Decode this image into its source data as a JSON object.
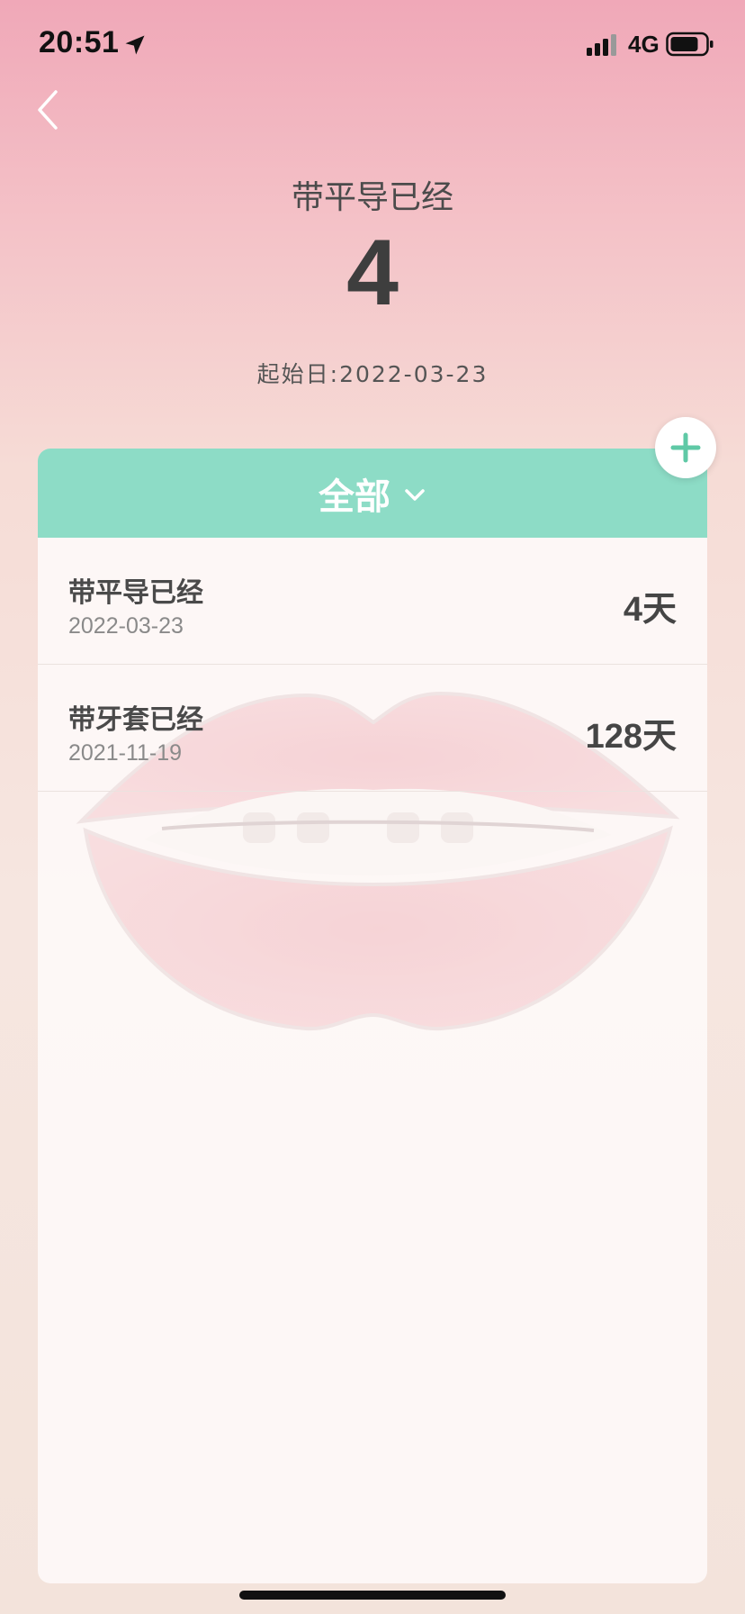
{
  "status_bar": {
    "time": "20:51",
    "network": "4G"
  },
  "header": {
    "title": "带平导已经",
    "count": "4",
    "start_date": "起始日:2022-03-23"
  },
  "filter": {
    "label": "全部"
  },
  "items": [
    {
      "title": "带平导已经",
      "date": "2022-03-23",
      "days": "4天"
    },
    {
      "title": "带牙套已经",
      "date": "2021-11-19",
      "days": "128天"
    }
  ],
  "colors": {
    "accent": "#8ddcc6",
    "add_icon": "#5fc9a6"
  },
  "icons": {
    "back": "chevron-left-icon",
    "add": "plus-icon",
    "filter_dropdown": "chevron-down-icon",
    "location": "location-arrow-icon",
    "signal": "signal-icon",
    "battery": "battery-icon"
  }
}
